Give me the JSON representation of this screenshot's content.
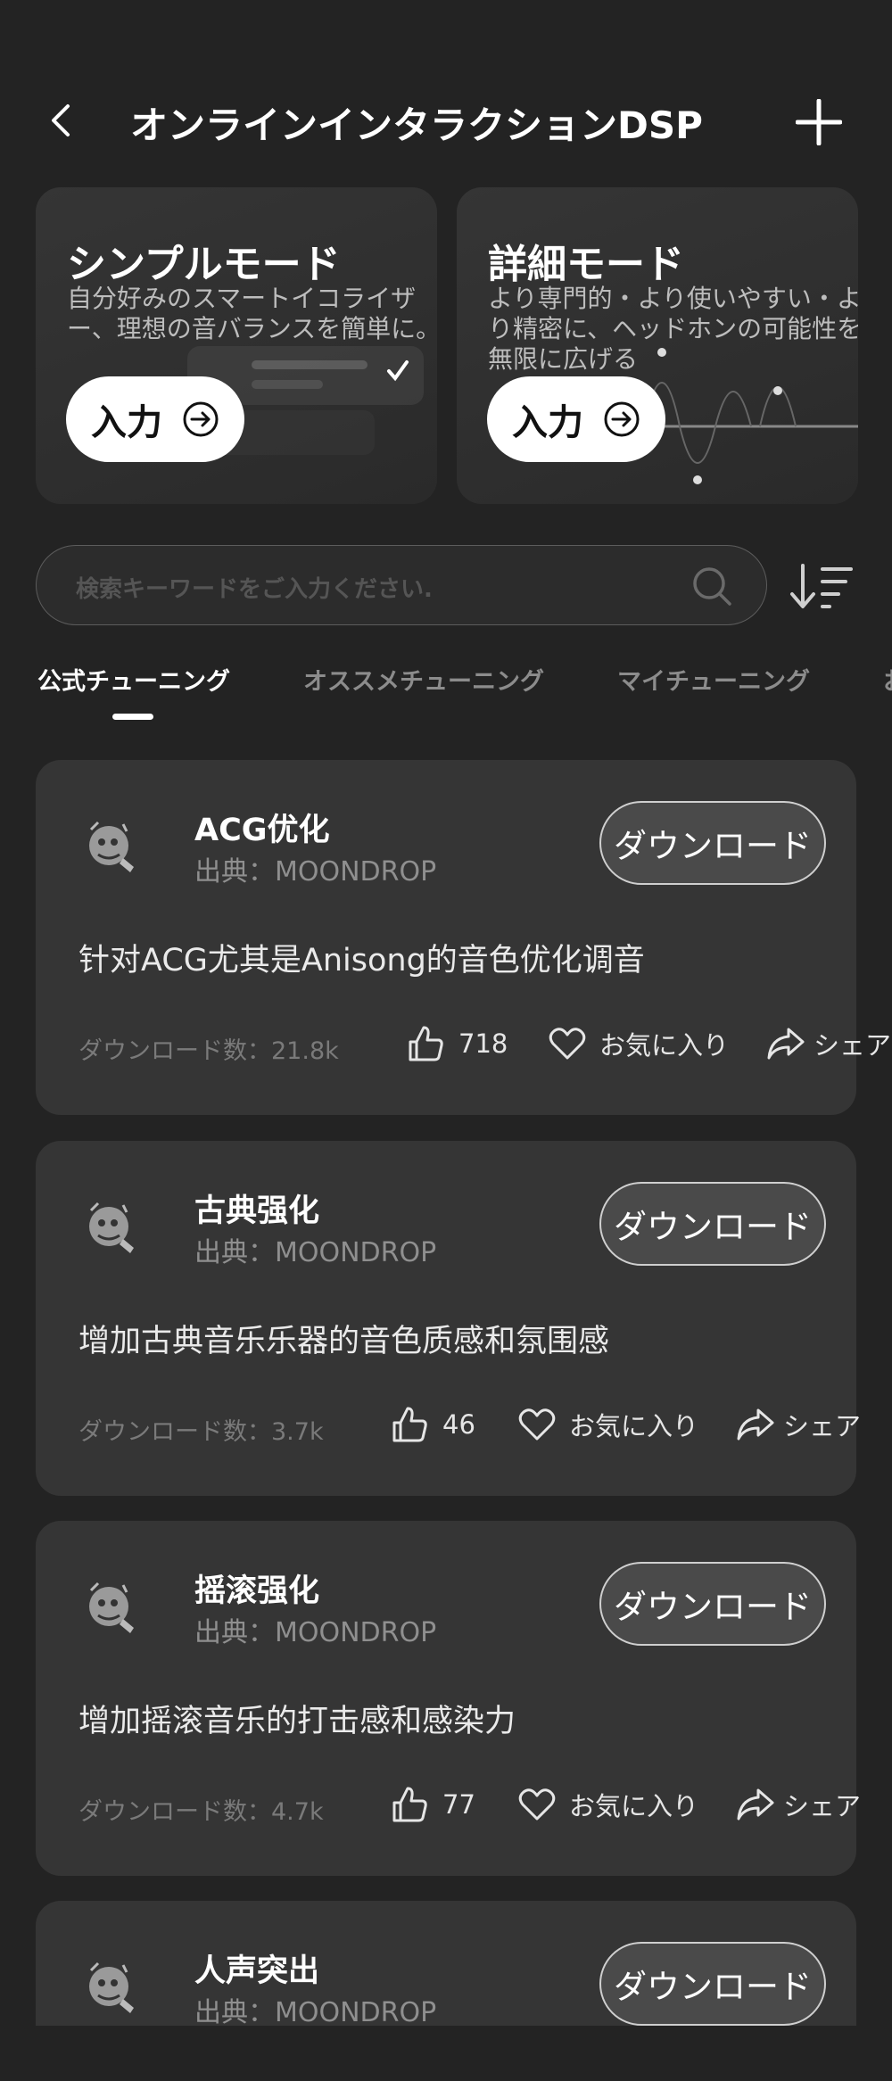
{
  "header": {
    "title": "オンラインインタラクションDSP",
    "back_icon": "chevron-left-icon",
    "add_icon": "plus-icon"
  },
  "modes": {
    "simple": {
      "title": "シンプルモード",
      "desc": "自分好みのスマートイコライザー、理想の音バランスを簡単に。",
      "button": "入力"
    },
    "detail": {
      "title": "詳細モード",
      "desc": "より専門的・より使いやすい・より精密に、ヘッドホンの可能性を無限に広げる",
      "button": "入力"
    }
  },
  "search": {
    "placeholder": "検索キーワードをご入力ください."
  },
  "tabs": [
    {
      "label": "公式チューニング",
      "active": true
    },
    {
      "label": "オススメチューニング",
      "active": false
    },
    {
      "label": "マイチューニング",
      "active": false
    },
    {
      "label": "お",
      "active": false
    }
  ],
  "list": [
    {
      "title": "ACG优化",
      "source": "出典：MOONDROP",
      "button": "ダウンロード",
      "desc": "针对ACG尤其是Anisong的音色优化调音",
      "downloads": "ダウンロード数：21.8k",
      "likes": "718",
      "fav": "お気に入り",
      "share": "シェア"
    },
    {
      "title": "古典强化",
      "source": "出典：MOONDROP",
      "button": "ダウンロード",
      "desc": "增加古典音乐乐器的音色质感和氛围感",
      "downloads": "ダウンロード数：3.7k",
      "likes": "46",
      "fav": "お気に入り",
      "share": "シェア"
    },
    {
      "title": "摇滚强化",
      "source": "出典：MOONDROP",
      "button": "ダウンロード",
      "desc": "增加摇滚音乐的打击感和感染力",
      "downloads": "ダウンロード数：4.7k",
      "likes": "77",
      "fav": "お気に入り",
      "share": "シェア"
    },
    {
      "title": "人声突出",
      "source": "出典：MOONDROP",
      "button": "ダウンロード"
    }
  ],
  "colors": {
    "background": "#232323",
    "card": "#353535",
    "accent": "#ffffff"
  }
}
